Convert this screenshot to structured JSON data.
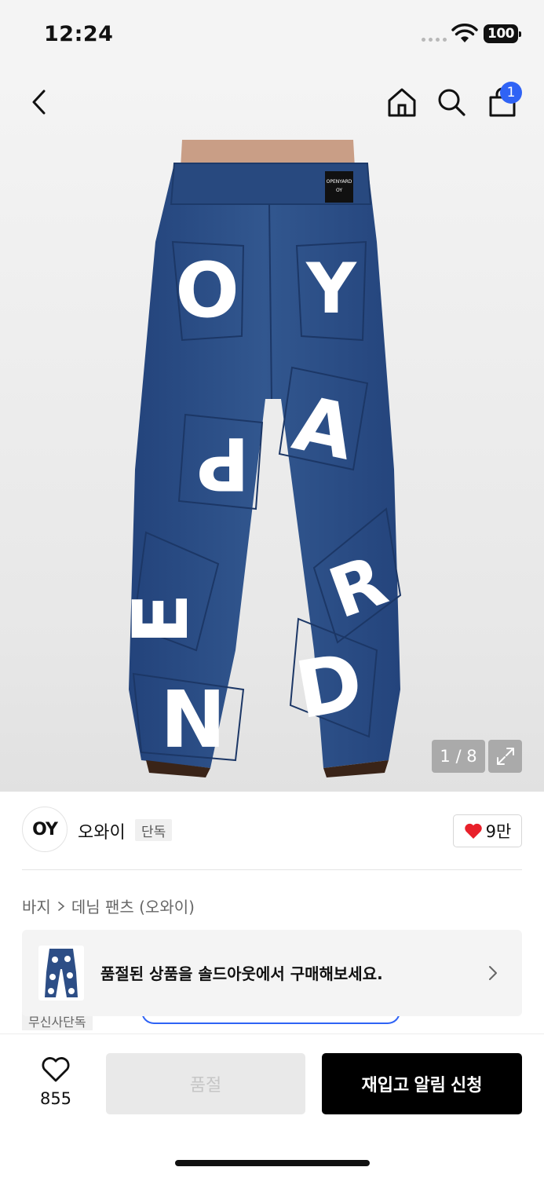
{
  "status_bar": {
    "time": "12:24",
    "battery": "100"
  },
  "header": {
    "cart_count": "1"
  },
  "gallery": {
    "counter": "1 / 8"
  },
  "brand": {
    "logo_text": "OY",
    "name": "오와이",
    "badge": "단독",
    "likes": "9만"
  },
  "breadcrumb": {
    "category": "바지",
    "subcategory": "데님 팬츠 (오와이)"
  },
  "banner": {
    "text": "품절된 상품을 솔드아웃에서 구매해보세요."
  },
  "peek": {
    "badge": "무신사단독"
  },
  "bottom_bar": {
    "wish_count": "855",
    "soldout_label": "품절",
    "restock_label": "재입고 알림 신청"
  },
  "colors": {
    "accent": "#2f63f5",
    "heart": "#e8202a",
    "denim": "#2d4e86"
  }
}
